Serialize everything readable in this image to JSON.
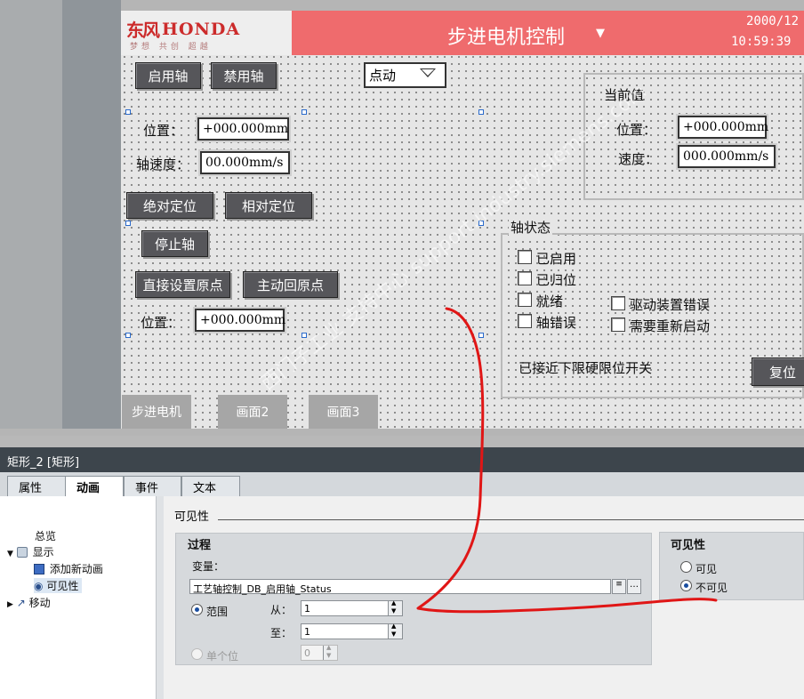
{
  "hmi": {
    "logo": {
      "mark": "东风",
      "brand": "HONDA",
      "tagline": "梦想 共创 超越"
    },
    "title": "步进电机控制",
    "date": "2000/12",
    "time": "10:59:39",
    "buttons": {
      "enable": "启用轴",
      "disable": "禁用轴",
      "absolute": "绝对定位",
      "relative": "相对定位",
      "stop": "停止轴",
      "set_origin": "直接设置原点",
      "home": "主动回原点",
      "reset": "复位"
    },
    "mode_select": "点动",
    "labels": {
      "position": "位置：",
      "axis_speed": "轴速度：",
      "position2": "位置："
    },
    "inputs": {
      "position": "+000.000mm",
      "axis_speed": "00.000mm/s",
      "origin_position": "+000.000mm"
    },
    "current": {
      "title": "当前值",
      "pos_label": "位置：",
      "pos_value": "+000.000mm",
      "speed_label": "速度：",
      "speed_value": "000.000mm/s"
    },
    "axis_status": {
      "title": "轴状态",
      "items": [
        "已启用",
        "已归位",
        "就绪",
        "轴错误"
      ],
      "items_right": [
        "驱动装置错误",
        "需要重新启动"
      ],
      "limit": "已接近下限硬限位开关"
    },
    "nav": [
      "步进电机",
      "画面2",
      "画面3"
    ]
  },
  "watermark": "西门子工业 支持中心 support.industry.siemens.com",
  "inspector": {
    "title": "矩形_2 [矩形]",
    "tabs": [
      "属性",
      "动画",
      "事件",
      "文本"
    ],
    "tree": {
      "overview": "总览",
      "display": "显示",
      "add_animation": "添加新动画",
      "visibility": "可见性",
      "move": "移动"
    },
    "section": "可见性",
    "process": {
      "title": "过程",
      "variable_label": "变量：",
      "variable": "工艺轴控制_DB_启用轴_Status",
      "range_label": "范围",
      "from_label": "从：",
      "from_value": "1",
      "to_label": "至：",
      "to_value": "1",
      "single_bit_label": "单个位",
      "single_bit_value": "0"
    },
    "visibility": {
      "title": "可见性",
      "visible": "可见",
      "invisible": "不可见",
      "selected": "不可见"
    }
  },
  "colors": {
    "title_red": "#ef6b6d",
    "button": "#56565a",
    "annotation": "#e01616",
    "panel_dark": "#3d454c"
  }
}
